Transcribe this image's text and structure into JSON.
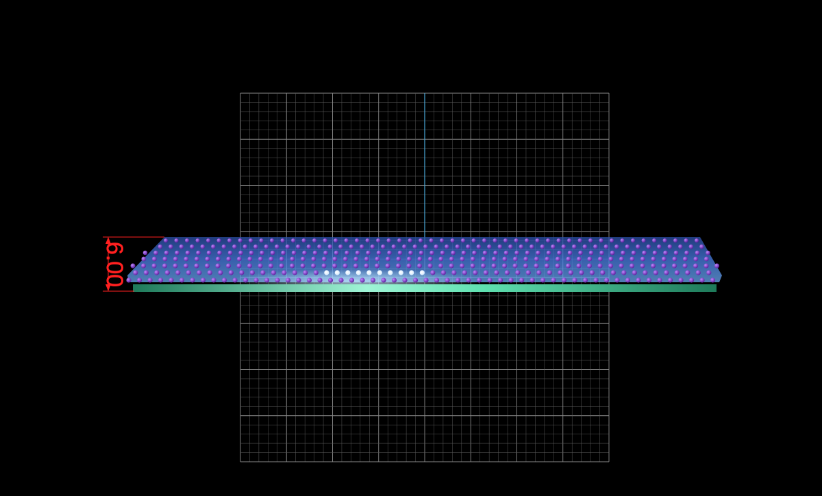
{
  "viewport": {
    "background_color": "#000000",
    "grid_color": "#5a5a5a",
    "grid_major_color": "#8a8a8a",
    "axis_color": "#4aa8d8",
    "view": "side-elevation"
  },
  "model": {
    "ring_color": "#3f6fd8",
    "ring_highlight_color": "#8fc8ff",
    "stone_color": "#7a2fc8",
    "stone_highlight_color": "#ffffff",
    "base_color": "#3fcf9a",
    "base_glow_color": "#9ff5d6"
  },
  "dimension": {
    "value_text": "6.00",
    "color": "#ff2020"
  }
}
